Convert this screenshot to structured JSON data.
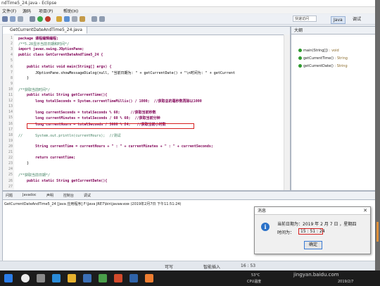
{
  "window": {
    "title": "ndTime5_24.java - Eclipse"
  },
  "menu": [
    "文件(F)",
    "源码",
    "项目(P)",
    "帮助(H)"
  ],
  "toolbar": {
    "quick_access": "快速访问",
    "perspective_java": "Java",
    "perspective_debug": "调试"
  },
  "editor": {
    "tab_label": "GetCurrentDateAndTime5_24.java",
    "line_numbers": [
      "1",
      "2",
      "3",
      "4",
      "5",
      "6",
      "7",
      "8",
      "9",
      "10",
      "11",
      "12",
      "13",
      "14",
      "15",
      "16",
      "17",
      "18",
      "19",
      "20",
      "21",
      "22",
      "23",
      "24",
      "25",
      "26",
      "27"
    ],
    "lines": [
      "package 课程编辑编程;",
      "/**5.28显示当前日期和时间*/",
      "import javax.swing.JOptionPane;",
      "public class GetCurrentDateAndTime5_24 {",
      "",
      "    public static void main(String[] args) {",
      "        JOptionPane.showMessageDialog(null, \"当前日期为: \" + getCurrentDate() + \"\\n时间为: \" + getCurrent",
      "    }",
      "",
      "/**获取当前时间*/",
      "    public static String getCurrentTime(){",
      "        long totalSeconds = System.currentTimeMillis() / 1000;  //获取总的毫秒数再除以1000",
      "",
      "        long currentSeconds = totalSeconds % 60;     //获取当前秒数",
      "        long currentMinutes = totalSeconds / 60 % 60;  //获取当前分钟",
      "        long currentHours = totalSeconds / 3600 % 24;   //获取当前小时数",
      "",
      "//      System.out.println(currentHours);  //测试",
      "",
      "        String currentTime = currentHours + \" : \" + currentMinutes + \" : \" + currentSeconds;",
      "",
      "        return currentTime;",
      "    }",
      "",
      "/**获取当前日期*/",
      "    public static String getCurrentDate(){",
      ""
    ]
  },
  "outline": {
    "title": "大纲",
    "items": [
      {
        "name": "main(String[])",
        "type": " : void"
      },
      {
        "name": "getCurrentTime()",
        "type": " : String"
      },
      {
        "name": "getCurrentDate()",
        "type": " : String"
      }
    ]
  },
  "console": {
    "tabs": [
      "问题",
      "Javadoc",
      "声明",
      "控制台",
      "调试"
    ],
    "line": "GetCurrentDateAndTime5_24 [Java 应用程序] F:\\Java JRE7\\bin\\javaw.exe  (2019年2月7日 下午11:51:24)"
  },
  "dialog": {
    "title": "消息",
    "date_line": "当前日期为：2019 年 2 月 7 日 ，星期四",
    "time_label": "时间为：",
    "time_value": "15 : 51 : 24",
    "ok_label": "确定"
  },
  "statusbar": {
    "writable": "可写",
    "insert_mode": "智能插入",
    "position": "16 : 53"
  },
  "taskbar": {
    "temp": "53°C",
    "temp_label": "CPU温度",
    "date": "2019/2/7"
  },
  "watermark": "jingyan.baidu.com"
}
